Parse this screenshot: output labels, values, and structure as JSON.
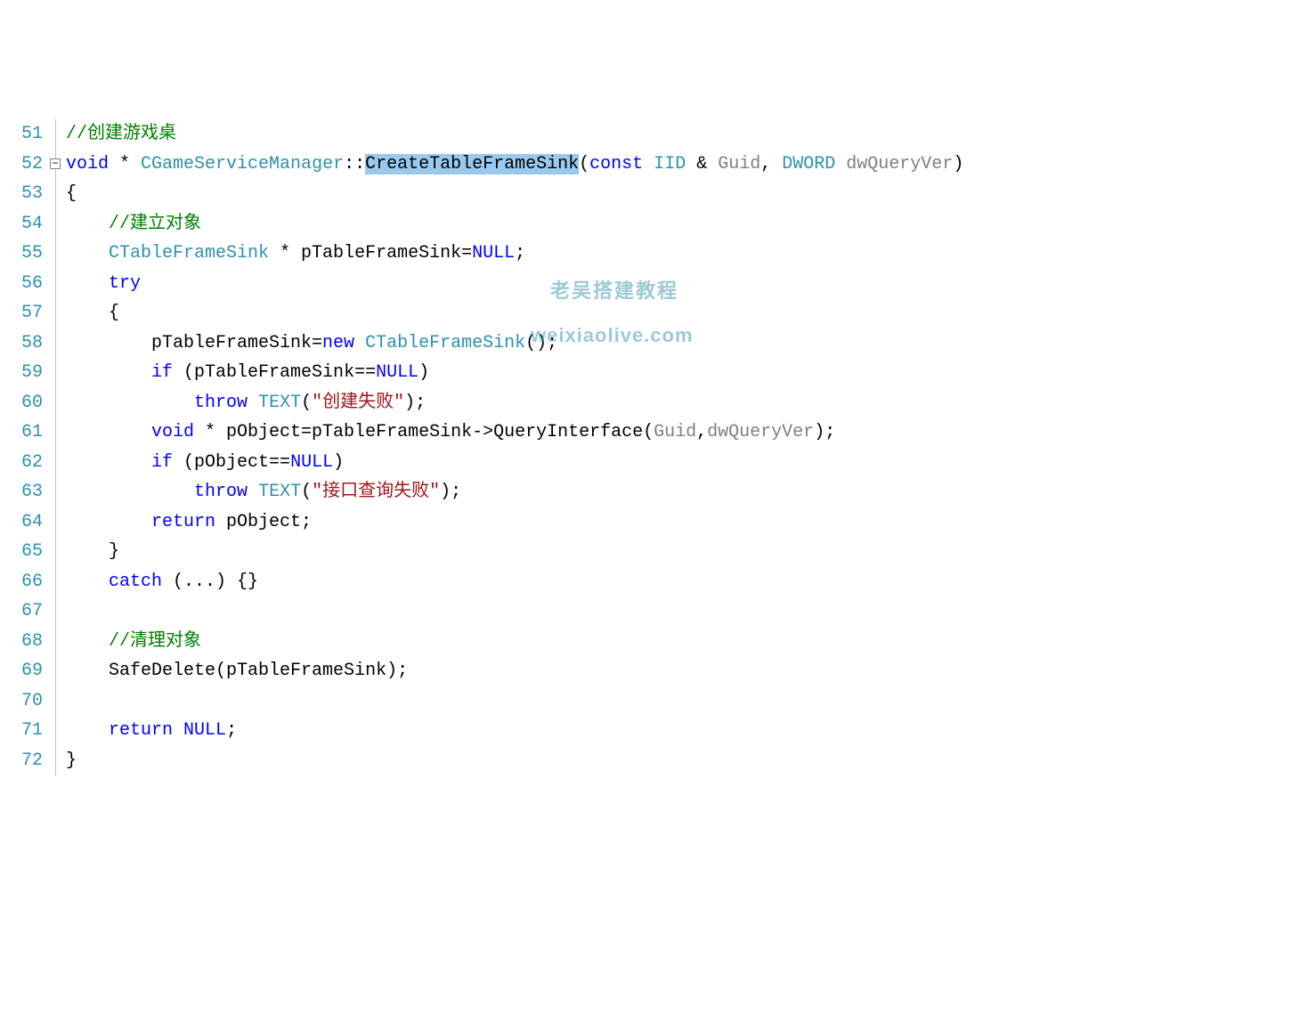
{
  "lineStart": 51,
  "foldLine": 52,
  "watermark": {
    "line1": "老吴搭建教程",
    "line2": "weixiaolive.com"
  },
  "code": [
    [
      {
        "indent": 0,
        "cls": "c-comment",
        "t": "//创建游戏桌"
      }
    ],
    [
      {
        "indent": 0,
        "cls": "c-keyword",
        "t": "void"
      },
      {
        "cls": "c-text",
        "t": " * "
      },
      {
        "cls": "c-type",
        "t": "CGameServiceManager"
      },
      {
        "cls": "c-text",
        "t": "::"
      },
      {
        "cls": "c-hl",
        "t": "CreateTableFrameSink"
      },
      {
        "cls": "c-text",
        "t": "("
      },
      {
        "cls": "c-keyword",
        "t": "const"
      },
      {
        "cls": "c-text",
        "t": " "
      },
      {
        "cls": "c-type",
        "t": "IID"
      },
      {
        "cls": "c-text",
        "t": " & "
      },
      {
        "cls": "c-ident",
        "t": "Guid"
      },
      {
        "cls": "c-text",
        "t": ", "
      },
      {
        "cls": "c-type",
        "t": "DWORD"
      },
      {
        "cls": "c-text",
        "t": " "
      },
      {
        "cls": "c-ident",
        "t": "dwQueryVer"
      },
      {
        "cls": "c-text",
        "t": ")"
      }
    ],
    [
      {
        "indent": 0,
        "cls": "c-text",
        "t": "{"
      }
    ],
    [
      {
        "indent": 1,
        "cls": "c-comment",
        "t": "//建立对象"
      }
    ],
    [
      {
        "indent": 1,
        "cls": "c-type",
        "t": "CTableFrameSink"
      },
      {
        "cls": "c-text",
        "t": " * pTableFrameSink="
      },
      {
        "cls": "c-keyword",
        "t": "NULL"
      },
      {
        "cls": "c-text",
        "t": ";"
      }
    ],
    [
      {
        "indent": 1,
        "cls": "c-keyword",
        "t": "try"
      }
    ],
    [
      {
        "indent": 1,
        "cls": "c-text",
        "t": "{"
      }
    ],
    [
      {
        "indent": 2,
        "cls": "c-text",
        "t": "pTableFrameSink="
      },
      {
        "cls": "c-keyword",
        "t": "new"
      },
      {
        "cls": "c-text",
        "t": " "
      },
      {
        "cls": "c-type",
        "t": "CTableFrameSink"
      },
      {
        "cls": "c-text",
        "t": "();"
      }
    ],
    [
      {
        "indent": 2,
        "cls": "c-keyword",
        "t": "if"
      },
      {
        "cls": "c-text",
        "t": " (pTableFrameSink=="
      },
      {
        "cls": "c-keyword",
        "t": "NULL"
      },
      {
        "cls": "c-text",
        "t": ")"
      }
    ],
    [
      {
        "indent": 3,
        "cls": "c-keyword",
        "t": "throw"
      },
      {
        "cls": "c-text",
        "t": " "
      },
      {
        "cls": "c-type",
        "t": "TEXT"
      },
      {
        "cls": "c-text",
        "t": "("
      },
      {
        "cls": "c-str",
        "t": "\"创建失败\""
      },
      {
        "cls": "c-text",
        "t": ");"
      }
    ],
    [
      {
        "indent": 2,
        "cls": "c-keyword",
        "t": "void"
      },
      {
        "cls": "c-text",
        "t": " * pObject=pTableFrameSink->QueryInterface("
      },
      {
        "cls": "c-ident",
        "t": "Guid"
      },
      {
        "cls": "c-text",
        "t": ","
      },
      {
        "cls": "c-ident",
        "t": "dwQueryVer"
      },
      {
        "cls": "c-text",
        "t": ");"
      }
    ],
    [
      {
        "indent": 2,
        "cls": "c-keyword",
        "t": "if"
      },
      {
        "cls": "c-text",
        "t": " (pObject=="
      },
      {
        "cls": "c-keyword",
        "t": "NULL"
      },
      {
        "cls": "c-text",
        "t": ")"
      }
    ],
    [
      {
        "indent": 3,
        "cls": "c-keyword",
        "t": "throw"
      },
      {
        "cls": "c-text",
        "t": " "
      },
      {
        "cls": "c-type",
        "t": "TEXT"
      },
      {
        "cls": "c-text",
        "t": "("
      },
      {
        "cls": "c-str",
        "t": "\"接口查询失败\""
      },
      {
        "cls": "c-text",
        "t": ");"
      }
    ],
    [
      {
        "indent": 2,
        "cls": "c-keyword",
        "t": "return"
      },
      {
        "cls": "c-text",
        "t": " pObject;"
      }
    ],
    [
      {
        "indent": 1,
        "cls": "c-text",
        "t": "}"
      }
    ],
    [
      {
        "indent": 1,
        "cls": "c-keyword",
        "t": "catch"
      },
      {
        "cls": "c-text",
        "t": " (...) {}"
      }
    ],
    [],
    [
      {
        "indent": 1,
        "cls": "c-comment",
        "t": "//清理对象"
      }
    ],
    [
      {
        "indent": 1,
        "cls": "c-text",
        "t": "SafeDelete(pTableFrameSink);"
      }
    ],
    [],
    [
      {
        "indent": 1,
        "cls": "c-keyword",
        "t": "return"
      },
      {
        "cls": "c-text",
        "t": " "
      },
      {
        "cls": "c-keyword",
        "t": "NULL"
      },
      {
        "cls": "c-text",
        "t": ";"
      }
    ],
    [
      {
        "indent": 0,
        "cls": "c-text",
        "t": "}"
      }
    ]
  ]
}
